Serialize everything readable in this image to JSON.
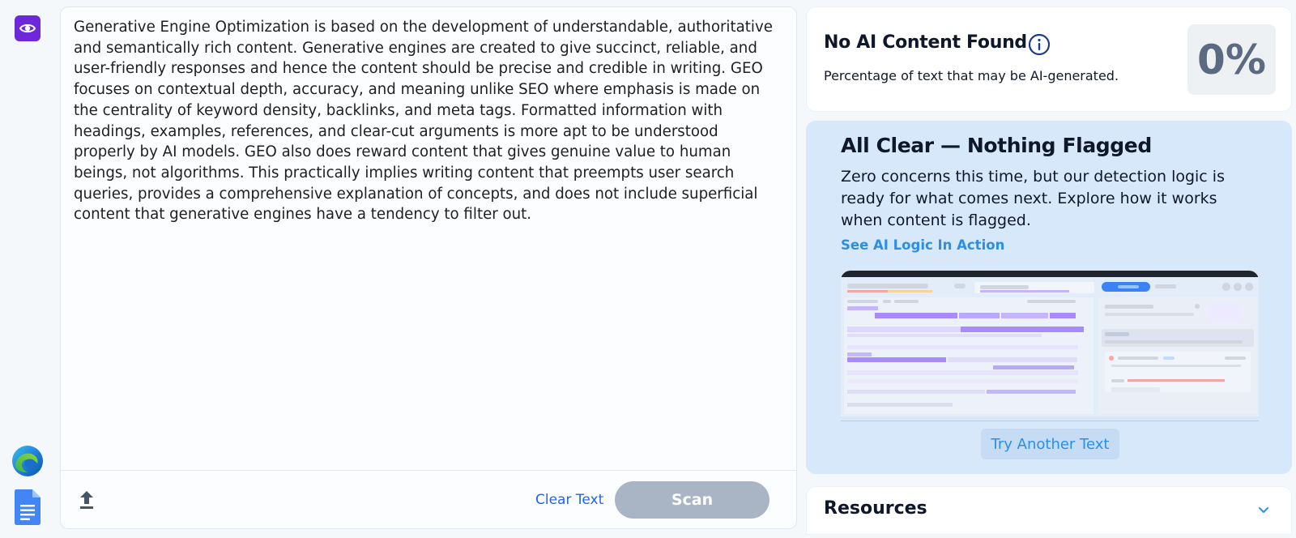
{
  "editor": {
    "text": "Generative Engine Optimization is based on the development of understandable, authoritative and semantically rich content. Generative engines are created to give succinct, reliable, and user-friendly responses and hence the content should be precise and credible in writing. GEO focuses on contextual depth, accuracy, and meaning unlike SEO where emphasis is made on the centrality of keyword density, backlinks, and meta tags. Formatted information with headings, examples, references, and clear-cut arguments is more apt to be understood properly by AI models. GEO also does reward content that gives genuine value to human beings, not algorithms. This practically implies writing content that preempts user search queries, provides a comprehensive explanation of concepts, and does not include superficial content that generative engines have a tendency to filter out.",
    "clear_label": "Clear Text",
    "scan_label": "Scan"
  },
  "result": {
    "title": "No AI Content Found",
    "subtitle": "Percentage of text that may be AI-generated.",
    "percentage": "0%"
  },
  "all_clear": {
    "heading": "All Clear — Nothing Flagged",
    "body": "Zero concerns this time, but our detection logic is ready for what comes next. Explore how it works when content is flagged.",
    "link": "See AI Logic In Action",
    "try_label": "Try Another Text"
  },
  "resources": {
    "label": "Resources"
  },
  "icons": {
    "brand": "eye-logo-icon",
    "upload": "upload-arrow-icon",
    "info": "info-circle-icon",
    "edge": "edge-browser-icon",
    "docs": "google-docs-icon",
    "chevron": "chevron-down-icon"
  },
  "colors": {
    "brand": "#6d28d9",
    "accent": "#2563eb",
    "link": "#2b8fe5",
    "scan_disabled": "#a9b5c5",
    "clear_card_bg": "#d7e8fb"
  }
}
